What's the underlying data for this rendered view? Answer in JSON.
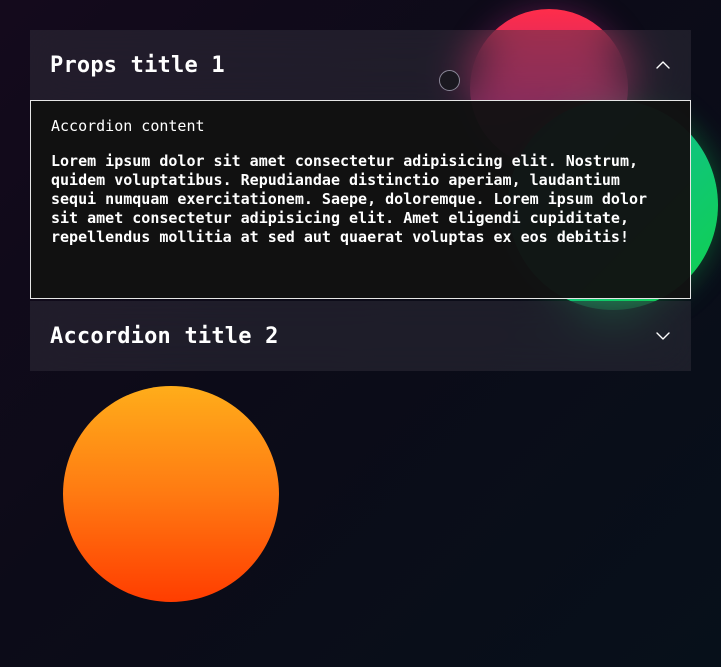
{
  "accordion": {
    "items": [
      {
        "title": "Props title 1",
        "expanded": true,
        "chevron": "chevron-up-icon",
        "content_heading": "Accordion content",
        "content_body": "Lorem ipsum dolor sit amet consectetur adipisicing elit. Nostrum, quidem voluptatibus. Repudiandae distinctio aperiam, laudantium sequi numquam exercitationem. Saepe, doloremque. Lorem ipsum dolor sit amet consectetur adipisicing elit. Amet eligendi cupiditate, repellendus mollitia at sed aut quaerat voluptas ex eos debitis!"
      },
      {
        "title": "Accordion title 2",
        "expanded": false,
        "chevron": "chevron-down-icon"
      }
    ]
  },
  "colors": {
    "background": "#0c0b18",
    "header_bg": "#2a2733",
    "panel_bg": "#121212",
    "panel_border": "#e6e6e6",
    "text": "#ffffff",
    "blob_pink": "#ff2d4a",
    "blob_green": "#10d24a",
    "blob_orange": "#ff7a12"
  }
}
